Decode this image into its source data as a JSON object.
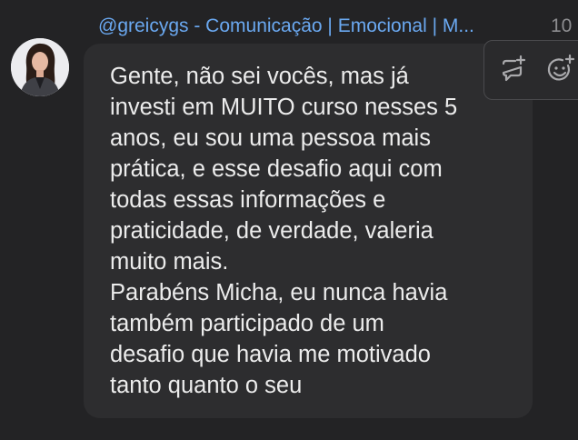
{
  "message": {
    "sender": "@greicygs - Comunicação | Emocional | M...",
    "time": "10",
    "lines": [
      "Gente, não sei vocês, mas já",
      "investi em MUITO curso nesses 5",
      "anos, eu sou uma pessoa mais",
      "prática, e esse desafio aqui com",
      "todas essas informações e",
      "praticidade, de verdade, valeria",
      "muito mais.",
      "Parabéns Micha, eu nunca havia",
      "também participado de um",
      "desafio que havia me motivado",
      "tanto quanto o seu"
    ]
  },
  "toolbar": {
    "icons": [
      "add-comment-icon",
      "add-reaction-icon"
    ]
  },
  "colors": {
    "background": "#232325",
    "bubble": "#2d2d2f",
    "sender": "#6aa8f0",
    "text": "#ececec"
  }
}
